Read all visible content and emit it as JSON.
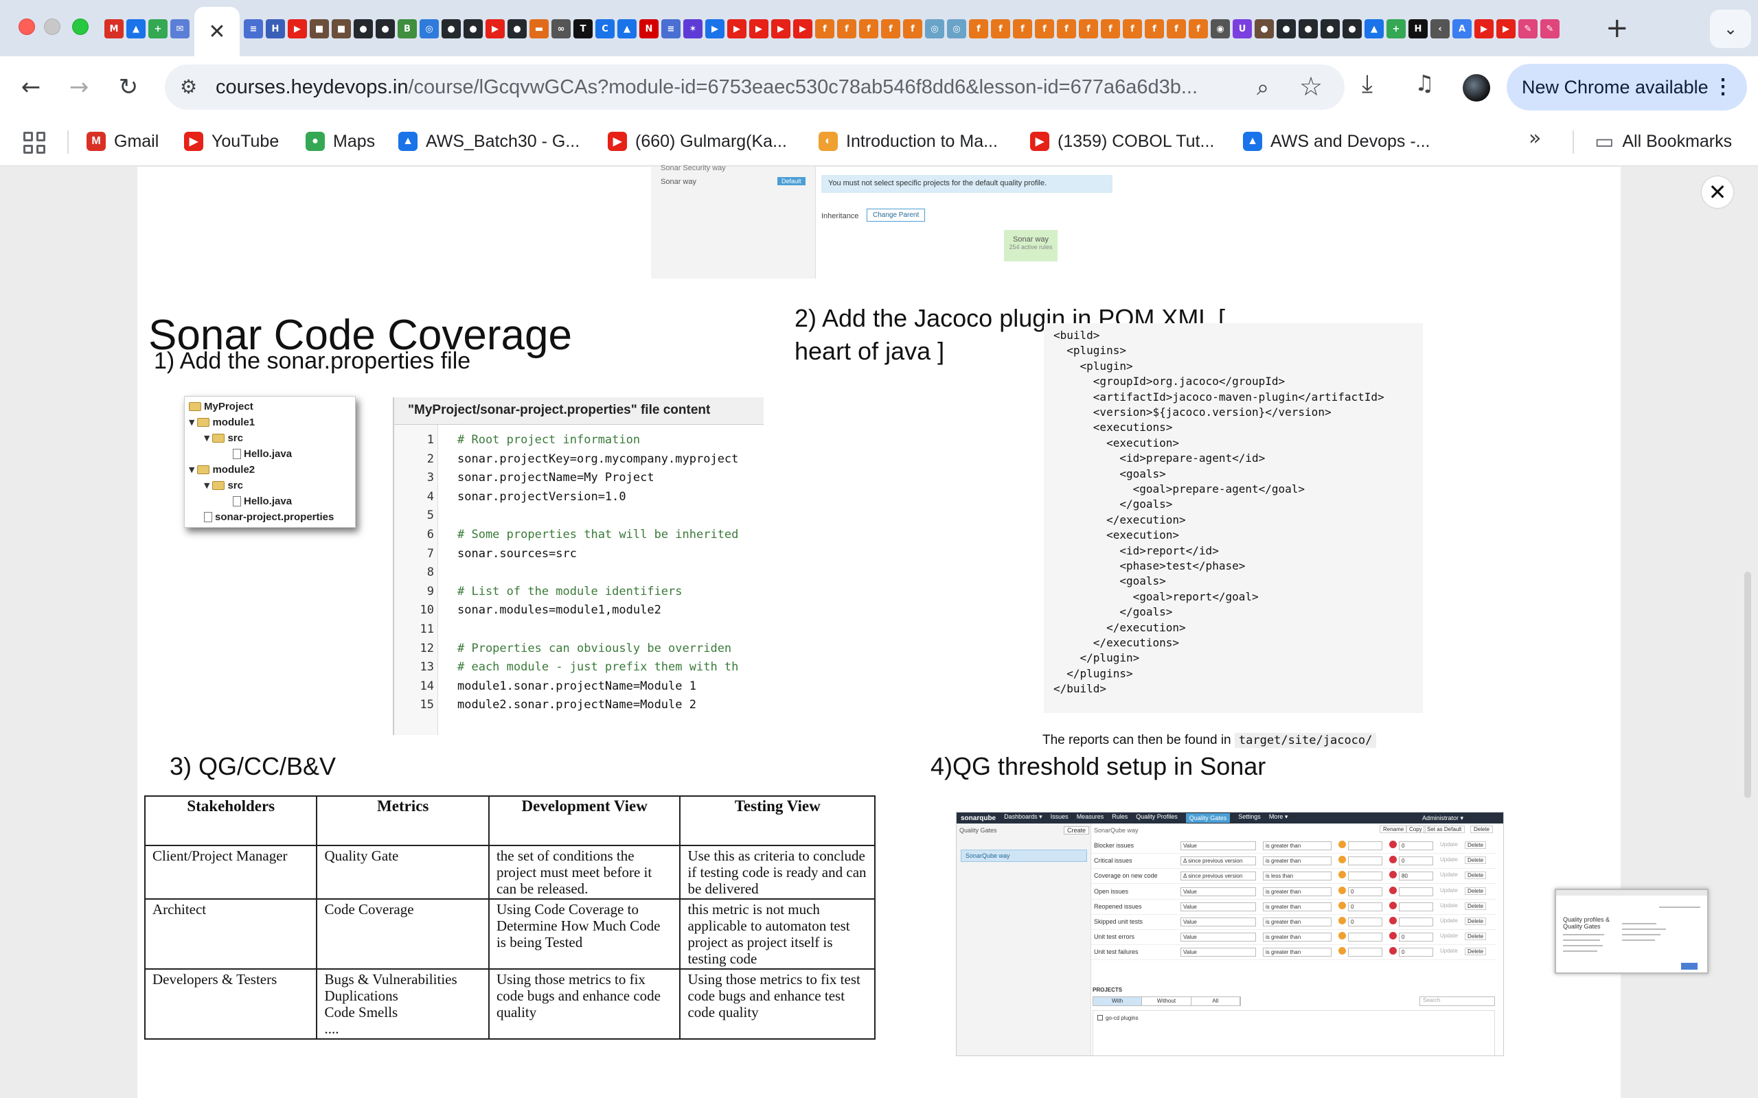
{
  "browser": {
    "active_tab_close": "✕",
    "new_tab": "+",
    "tab_menu": "⌄",
    "url_host": "courses.heydevops.in",
    "url_rest": "/course/lGcqvwGCAs?module-id=6753eaec530c78ab546f8dd6&lesson-id=677a6a6d3b...",
    "update_label": "New Chrome available",
    "tab_favicons_left": [
      {
        "glyph": "M",
        "color": "#d93025"
      },
      {
        "glyph": "▲",
        "color": "#1a73e8"
      },
      {
        "glyph": "+",
        "color": "#34a853"
      },
      {
        "glyph": "✉",
        "color": "#5b7fd6"
      }
    ],
    "tab_favicons_right": [
      {
        "glyph": "≡",
        "color": "#4a6fd3"
      },
      {
        "glyph": "H",
        "color": "#3a5fb8"
      },
      {
        "glyph": "▶",
        "color": "#e62117"
      },
      {
        "glyph": "■",
        "color": "#6b4f3a"
      },
      {
        "glyph": "■",
        "color": "#6b4f3a"
      },
      {
        "glyph": "●",
        "color": "#24292e"
      },
      {
        "glyph": "●",
        "color": "#24292e"
      },
      {
        "glyph": "B",
        "color": "#3f8f3f"
      },
      {
        "glyph": "◎",
        "color": "#2f7bdc"
      },
      {
        "glyph": "●",
        "color": "#24292e"
      },
      {
        "glyph": "●",
        "color": "#24292e"
      },
      {
        "glyph": "▶",
        "color": "#e62117"
      },
      {
        "glyph": "●",
        "color": "#24292e"
      },
      {
        "glyph": "▬",
        "color": "#e06c1b"
      },
      {
        "glyph": "∞",
        "color": "#555555"
      },
      {
        "glyph": "T",
        "color": "#111111"
      },
      {
        "glyph": "C",
        "color": "#1a73e8"
      },
      {
        "glyph": "▲",
        "color": "#1a73e8"
      },
      {
        "glyph": "N",
        "color": "#d40000"
      },
      {
        "glyph": "≡",
        "color": "#4a6fd3"
      },
      {
        "glyph": "✶",
        "color": "#5e3bd6"
      },
      {
        "glyph": "▶",
        "color": "#1a73e8"
      },
      {
        "glyph": "▶",
        "color": "#e62117"
      },
      {
        "glyph": "▶",
        "color": "#e62117"
      },
      {
        "glyph": "▶",
        "color": "#e62117"
      },
      {
        "glyph": "▶",
        "color": "#e62117"
      },
      {
        "glyph": "f",
        "color": "#e8761b"
      },
      {
        "glyph": "f",
        "color": "#e8761b"
      },
      {
        "glyph": "f",
        "color": "#e8761b"
      },
      {
        "glyph": "f",
        "color": "#e8761b"
      },
      {
        "glyph": "f",
        "color": "#e8761b"
      },
      {
        "glyph": "◎",
        "color": "#6aa3c8"
      },
      {
        "glyph": "◎",
        "color": "#6aa3c8"
      },
      {
        "glyph": "f",
        "color": "#e8761b"
      },
      {
        "glyph": "f",
        "color": "#e8761b"
      },
      {
        "glyph": "f",
        "color": "#e8761b"
      },
      {
        "glyph": "f",
        "color": "#e8761b"
      },
      {
        "glyph": "f",
        "color": "#e8761b"
      },
      {
        "glyph": "f",
        "color": "#e8761b"
      },
      {
        "glyph": "f",
        "color": "#e8761b"
      },
      {
        "glyph": "f",
        "color": "#e8761b"
      },
      {
        "glyph": "f",
        "color": "#e8761b"
      },
      {
        "glyph": "f",
        "color": "#e8761b"
      },
      {
        "glyph": "f",
        "color": "#e8761b"
      },
      {
        "glyph": "◉",
        "color": "#555555"
      },
      {
        "glyph": "U",
        "color": "#7b3fe0"
      },
      {
        "glyph": "●",
        "color": "#6b4f3a"
      },
      {
        "glyph": "●",
        "color": "#24292e"
      },
      {
        "glyph": "●",
        "color": "#24292e"
      },
      {
        "glyph": "●",
        "color": "#24292e"
      },
      {
        "glyph": "●",
        "color": "#24292e"
      },
      {
        "glyph": "▲",
        "color": "#1a73e8"
      },
      {
        "glyph": "+",
        "color": "#34a853"
      },
      {
        "glyph": "H",
        "color": "#111111"
      },
      {
        "glyph": "‹",
        "color": "#555555"
      },
      {
        "glyph": "A",
        "color": "#3a7ef0"
      },
      {
        "glyph": "▶",
        "color": "#e62117"
      },
      {
        "glyph": "▶",
        "color": "#e62117"
      },
      {
        "glyph": "✎",
        "color": "#e0457b"
      },
      {
        "glyph": "✎",
        "color": "#e0457b"
      }
    ]
  },
  "bookmarks": {
    "items": [
      {
        "label": "Gmail",
        "icon": "M",
        "color": "#d93025"
      },
      {
        "label": "YouTube",
        "icon": "▶",
        "color": "#e62117"
      },
      {
        "label": "Maps",
        "icon": "●",
        "color": "#34a853"
      },
      {
        "label": "AWS_Batch30 - G...",
        "icon": "▲",
        "color": "#1a73e8"
      },
      {
        "label": "(660) Gulmarg(Ka...",
        "icon": "▶",
        "color": "#e62117"
      },
      {
        "label": "Introduction to Ma...",
        "icon": "◐",
        "color": "#f0a030"
      },
      {
        "label": "(1359) COBOL Tut...",
        "icon": "▶",
        "color": "#e62117"
      },
      {
        "label": "AWS and Devops -...",
        "icon": "▲",
        "color": "#1a73e8"
      }
    ],
    "more": "»",
    "all_bookmarks": "All Bookmarks"
  },
  "viewer": {
    "close": "✕"
  },
  "quality_profile_shot": {
    "row1": "Sonar Security way",
    "row2": "Sonar way",
    "default_badge": "Default",
    "message": "You must not select specific projects for the default quality profile.",
    "inheritance_label": "Inheritance",
    "change_parent": "Change Parent",
    "box_title": "Sonar way",
    "box_sub": "254 active rules"
  },
  "slide": {
    "title": "Sonar Code Coverage",
    "step1": "1) Add the sonar.properties file",
    "step2": "2) Add the Jacoco plugin in POM.XML [ heart of java ]",
    "step3": "3) QG/CC/B&V",
    "step4": "4)QG threshold setup in Sonar",
    "reports_text": "The reports can then be found in",
    "reports_path": "target/site/jacoco/"
  },
  "file_tree": {
    "root": "MyProject",
    "module1": "module1",
    "src1": "src",
    "file1": "Hello.java",
    "module2": "module2",
    "src2": "src",
    "file2": "Hello.java",
    "props": "sonar-project.properties"
  },
  "properties_file": {
    "header": "\"MyProject/sonar-project.properties\" file content",
    "lines": [
      {
        "n": "1",
        "t": "# Root project information",
        "comment": true
      },
      {
        "n": "2",
        "t": "sonar.projectKey=org.mycompany.myproject",
        "comment": false
      },
      {
        "n": "3",
        "t": "sonar.projectName=My Project",
        "comment": false
      },
      {
        "n": "4",
        "t": "sonar.projectVersion=1.0",
        "comment": false
      },
      {
        "n": "5",
        "t": "",
        "comment": false
      },
      {
        "n": "6",
        "t": "# Some properties that will be inherited",
        "comment": true
      },
      {
        "n": "7",
        "t": "sonar.sources=src",
        "comment": false
      },
      {
        "n": "8",
        "t": "",
        "comment": false
      },
      {
        "n": "9",
        "t": "# List of the module identifiers",
        "comment": true
      },
      {
        "n": "10",
        "t": "sonar.modules=module1,module2",
        "comment": false
      },
      {
        "n": "11",
        "t": "",
        "comment": false
      },
      {
        "n": "12",
        "t": "# Properties can obviously be overriden",
        "comment": true
      },
      {
        "n": "13",
        "t": "# each module - just prefix them with th",
        "comment": true
      },
      {
        "n": "14",
        "t": "module1.sonar.projectName=Module 1",
        "comment": false
      },
      {
        "n": "15",
        "t": "module2.sonar.projectName=Module 2",
        "comment": false
      }
    ]
  },
  "pom_xml": {
    "lines": [
      "<build>",
      "  <plugins>",
      "    <plugin>",
      "      <groupId>org.jacoco</groupId>",
      "      <artifactId>jacoco-maven-plugin</artifactId>",
      "      <version>${jacoco.version}</version>",
      "      <executions>",
      "        <execution>",
      "          <id>prepare-agent</id>",
      "          <goals>",
      "            <goal>prepare-agent</goal>",
      "          </goals>",
      "        </execution>",
      "        <execution>",
      "          <id>report</id>",
      "          <phase>test</phase>",
      "          <goals>",
      "            <goal>report</goal>",
      "          </goals>",
      "        </execution>",
      "      </executions>",
      "    </plugin>",
      "  </plugins>",
      "</build>"
    ]
  },
  "qg_table": {
    "headers": [
      "Stakeholders",
      "Metrics",
      "Development View",
      "Testing View"
    ],
    "rows": [
      [
        "Client/Project Manager",
        "Quality Gate",
        "the set of conditions the project must meet before it can be released.",
        "Use this as criteria to conclude if testing code is ready and can be delivered"
      ],
      [
        "Architect",
        "Code Coverage",
        "Using Code Coverage to Determine How Much Code is being Tested",
        "this metric is not much applicable to automaton test project as project itself is testing code"
      ],
      [
        "Developers & Testers",
        "Bugs & Vulnerabilities\nDuplications\nCode Smells\n....",
        "Using those metrics to fix code bugs and enhance code quality",
        "Using those metrics to fix test code bugs and enhance test code quality"
      ]
    ]
  },
  "sonarqube": {
    "logo": "sonarqube",
    "nav": [
      "Dashboards ▾",
      "Issues",
      "Measures",
      "Rules",
      "Quality Profiles",
      "Quality Gates",
      "Settings",
      "More ▾"
    ],
    "active_nav": "Quality Gates",
    "admin": "Administrator ▾",
    "side_header": "Quality Gates",
    "create": "Create",
    "gate_name": "SonarQube way",
    "main_title": "SonarQube way",
    "actions": [
      "Rename",
      "Copy",
      "Set as Default",
      "Delete"
    ],
    "conditions": [
      {
        "metric": "Blocker issues",
        "period": "Value",
        "op": "is greater than",
        "warn": "",
        "error": "0"
      },
      {
        "metric": "Critical issues",
        "period": "Δ since previous version",
        "op": "is greater than",
        "warn": "",
        "error": "0"
      },
      {
        "metric": "Coverage on new code",
        "period": "Δ since previous version",
        "op": "is less than",
        "warn": "",
        "error": "80"
      },
      {
        "metric": "Open issues",
        "period": "Value",
        "op": "is greater than",
        "warn": "0",
        "error": ""
      },
      {
        "metric": "Reopened issues",
        "period": "Value",
        "op": "is greater than",
        "warn": "0",
        "error": ""
      },
      {
        "metric": "Skipped unit tests",
        "period": "Value",
        "op": "is greater than",
        "warn": "0",
        "error": ""
      },
      {
        "metric": "Unit test errors",
        "period": "Value",
        "op": "is greater than",
        "warn": "",
        "error": "0"
      },
      {
        "metric": "Unit test failures",
        "period": "Value",
        "op": "is greater than",
        "warn": "",
        "error": "0"
      }
    ],
    "update": "Update",
    "delete": "Delete",
    "projects_label": "PROJECTS",
    "tabs": [
      "With",
      "Without",
      "All"
    ],
    "search": "Search",
    "project_item": "go-cd plugins"
  },
  "thumbnail": {
    "title": "Quality profiles & Quality Gates"
  }
}
